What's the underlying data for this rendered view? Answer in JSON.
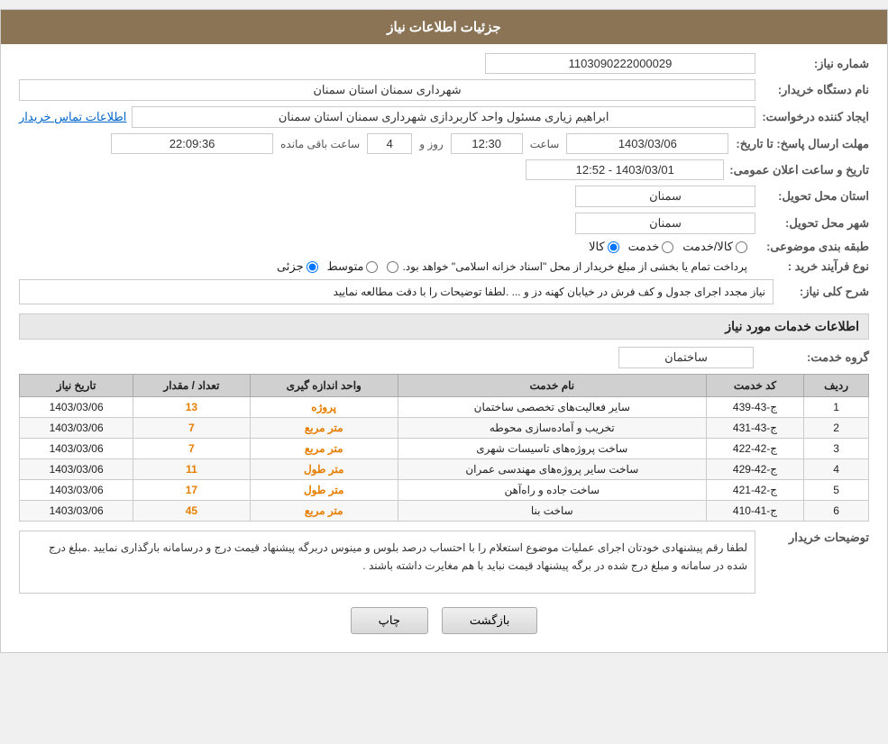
{
  "header": {
    "title": "جزئیات اطلاعات نیاز"
  },
  "fields": {
    "shomara_niaz_label": "شماره نیاز:",
    "shomara_niaz_value": "1103090222000029",
    "nam_dastgah_label": "نام دستگاه خریدار:",
    "nam_dastgah_value": "شهرداری سمنان استان سمنان",
    "ijad_label": "ایجاد کننده درخواست:",
    "ijad_value": "ابراهیم زیاری مسئول واحد کاربردازی شهرداری سمنان استان سمنان",
    "ijad_link": "اطلاعات تماس خریدار",
    "mohlat_label": "مهلت ارسال پاسخ: تا تاریخ:",
    "mohlat_date": "1403/03/06",
    "mohlat_time_label": "ساعت",
    "mohlat_time": "12:30",
    "mohlat_day_label": "روز و",
    "mohlat_days": "4",
    "mohlat_remaining_label": "ساعت باقی مانده",
    "mohlat_remaining": "22:09:36",
    "ostan_tahvil_label": "استان محل تحویل:",
    "ostan_tahvil_value": "سمنان",
    "shahr_tahvil_label": "شهر محل تحویل:",
    "shahr_tahvil_value": "سمنان",
    "taraghomi_label": "طبقه بندی موضوعی:",
    "taraghomi_options": [
      "کالا",
      "خدمت",
      "کالا/خدمت"
    ],
    "taraghomi_selected": "کالا",
    "farayand_label": "نوع فرآیند خرید :",
    "farayand_options": [
      "جزئی",
      "متوسط",
      "پرداخت تمام یا بخشی از مبلغ خریدار از محل \"اسناد خزانه اسلامی\" خواهد بود."
    ],
    "farayand_selected": "جزئی",
    "tarikh_label": "تاریخ و ساعت اعلان عمومی:",
    "tarikh_value": "1403/03/01 - 12:52"
  },
  "sharh_section": {
    "title": "شرح کلی نیاز:",
    "value": "نیاز مجدد اجرای جدول و کف فرش در خیابان کهنه دز و ... .لطفا توضیحات را با دقت مطالعه نمایید"
  },
  "khadamat_section": {
    "title": "اطلاعات خدمات مورد نیاز",
    "group_label": "گروه خدمت:",
    "group_value": "ساختمان"
  },
  "table": {
    "headers": [
      "ردیف",
      "کد خدمت",
      "نام خدمت",
      "واحد اندازه گیری",
      "تعداد / مقدار",
      "تاریخ نیاز"
    ],
    "rows": [
      {
        "radif": "1",
        "kod": "ج-43-439",
        "name": "سایر فعالیت‌های تخصصی ساختمان",
        "unit": "پروژه",
        "qty": "13",
        "date": "1403/03/06"
      },
      {
        "radif": "2",
        "kod": "ج-43-431",
        "name": "تخریب و آماده‌سازی محوطه",
        "unit": "متر مربع",
        "qty": "7",
        "date": "1403/03/06"
      },
      {
        "radif": "3",
        "kod": "ج-42-422",
        "name": "ساخت پروژه‌های تاسیسات شهری",
        "unit": "متر مربع",
        "qty": "7",
        "date": "1403/03/06"
      },
      {
        "radif": "4",
        "kod": "ج-42-429",
        "name": "ساخت سایر پروژه‌های مهندسی عمران",
        "unit": "متر طول",
        "qty": "11",
        "date": "1403/03/06"
      },
      {
        "radif": "5",
        "kod": "ج-42-421",
        "name": "ساخت جاده و راه‌آهن",
        "unit": "متر طول",
        "qty": "17",
        "date": "1403/03/06"
      },
      {
        "radif": "6",
        "kod": "ج-41-410",
        "name": "ساخت بنا",
        "unit": "متر مربع",
        "qty": "45",
        "date": "1403/03/06"
      }
    ]
  },
  "tawziyat_section": {
    "title": "توضیحات خریدار",
    "value": "لطفا رقم پیشنهادی خودتان اجرای عملیات موضوع استعلام را با احتساب درصد بلوس و مینوس دربرگه پیشنهاد قیمت درج و درسامانه بارگذاری نمایید .مبلغ درج شده در سامانه و مبلغ درج شده در برگه پیشنهاد قیمت نباید با هم مغایرت داشته باشند ."
  },
  "buttons": {
    "print": "چاپ",
    "back": "بازگشت"
  }
}
